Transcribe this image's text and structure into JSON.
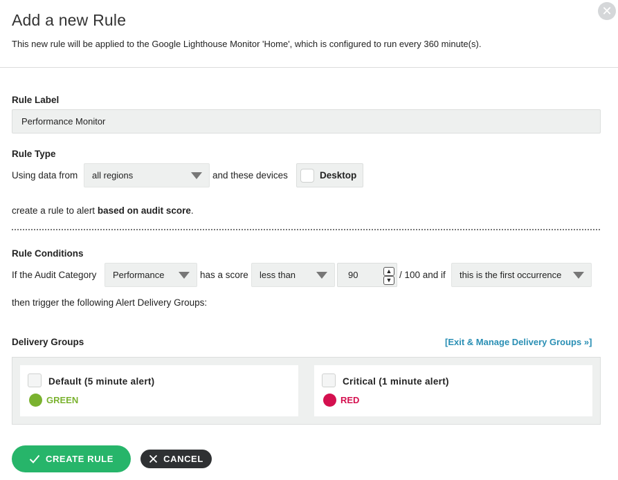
{
  "header": {
    "title": "Add a new Rule",
    "subtitle": "This new rule will be applied to the Google Lighthouse Monitor 'Home', which is configured to run every 360 minute(s)."
  },
  "rule_label": {
    "heading": "Rule Label",
    "value": "Performance Monitor"
  },
  "rule_type": {
    "heading": "Rule Type",
    "using_data_from": "Using data from",
    "region_selected": "all regions",
    "and_these_devices": "and these devices",
    "device_label": "Desktop",
    "create_prefix": "create a rule to alert",
    "create_bold": "based on audit score",
    "create_suffix": "."
  },
  "rule_conditions": {
    "heading": "Rule Conditions",
    "if_category": "If the Audit Category",
    "category_selected": "Performance",
    "has_score": "has a score",
    "comparator_selected": "less than",
    "score_value": "90",
    "out_of": "/ 100 and if",
    "occurrence_selected": "this is the first occurrence",
    "then_trigger": "then trigger the following Alert Delivery Groups:"
  },
  "delivery_groups": {
    "heading": "Delivery Groups",
    "manage_link": "[Exit & Manage Delivery Groups »]",
    "groups": [
      {
        "name": "Default (5 minute alert)",
        "color_label": "GREEN",
        "color": "#7ab22f"
      },
      {
        "name": "Critical (1 minute alert)",
        "color_label": "RED",
        "color": "#d4104f"
      }
    ]
  },
  "actions": {
    "create_label": "CREATE RULE",
    "cancel_label": "CANCEL"
  },
  "icons": {
    "close": "close-icon",
    "check": "check-icon",
    "x": "x-icon",
    "caret": "caret-down-icon"
  }
}
